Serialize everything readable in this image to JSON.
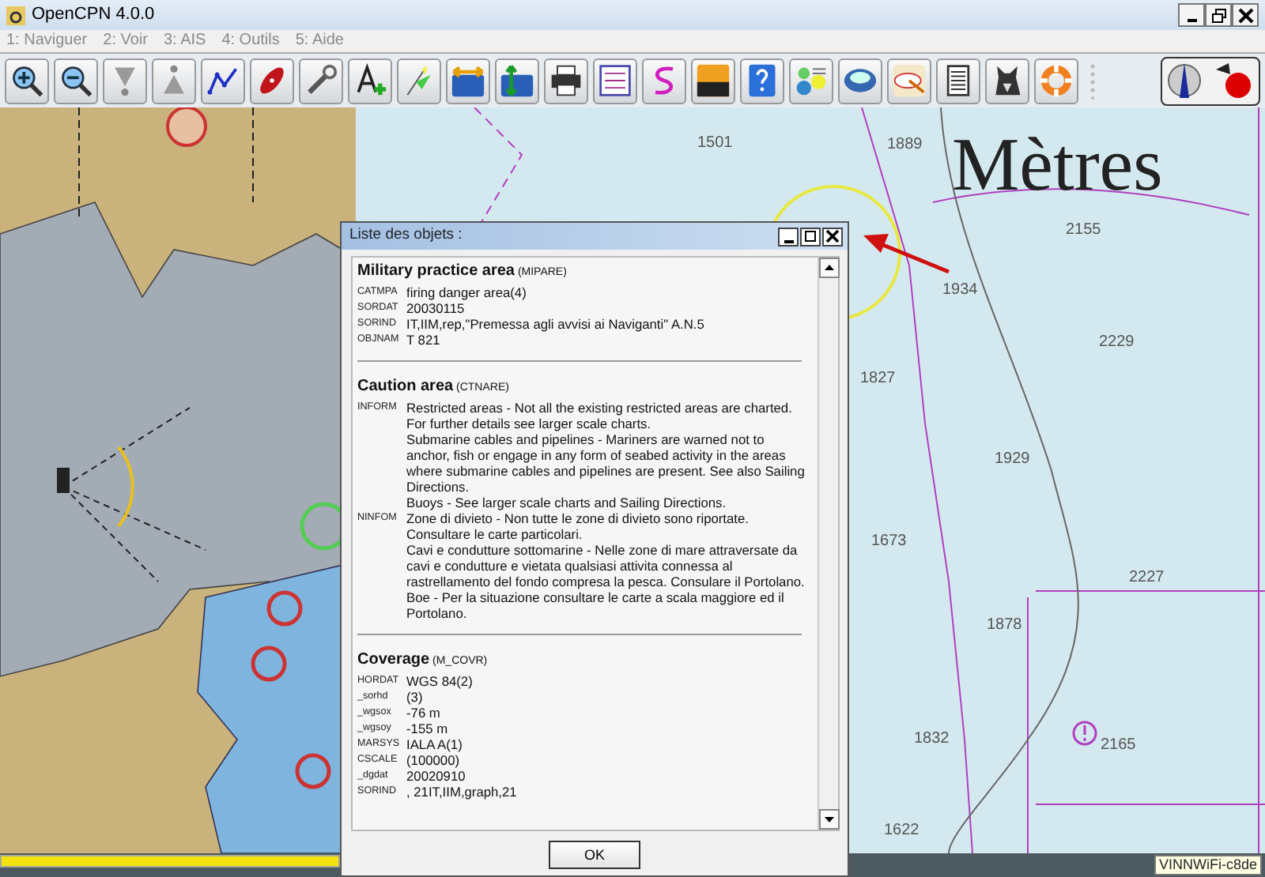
{
  "window": {
    "title": "OpenCPN 4.0.0"
  },
  "menu": [
    "1: Naviguer",
    "2: Voir",
    "3: AIS",
    "4: Outils",
    "5: Aide"
  ],
  "chart": {
    "units_label": "Mètres",
    "soundings": [
      "1501",
      "1889",
      "2155",
      "1934",
      "2229",
      "1827",
      "1929",
      "1673",
      "2227",
      "1878",
      "1832",
      "2165",
      "1622"
    ]
  },
  "dialog": {
    "title": "Liste des objets :",
    "sections": [
      {
        "name": "Military practice area",
        "code": "(MIPARE)",
        "attributes": [
          {
            "key": "CATMPA",
            "value": [
              "firing danger area(4)"
            ]
          },
          {
            "key": "SORDAT",
            "value": [
              "20030115"
            ]
          },
          {
            "key": "SORIND",
            "value": [
              "IT,IIM,rep,\"Premessa agli avvisi ai Naviganti\" A.N.5"
            ]
          },
          {
            "key": "OBJNAM",
            "value": [
              "T 821"
            ]
          }
        ]
      },
      {
        "name": "Caution area",
        "code": "(CTNARE)",
        "attributes": [
          {
            "key": "INFORM",
            "value": [
              "Restricted areas - Not all the existing restricted areas are charted.",
              "For further details see larger scale charts.",
              "Submarine cables and pipelines - Mariners are warned not to anchor, fish or engage in any form of seabed activity in the areas where submarine cables and pipelines are present. See also Sailing Directions.",
              "Buoys - See larger scale charts and Sailing Directions."
            ]
          },
          {
            "key": "NINFOM",
            "value": [
              "Zone di divieto - Non tutte le zone di divieto sono riportate.",
              "Consultare le carte particolari.",
              "Cavi e condutture sottomarine - Nelle zone di mare attraversate da cavi e condutture e vietata qualsiasi attivita connessa al rastrellamento del fondo compresa la pesca. Consulare il Portolano.",
              "Boe - Per la situazione consultare le carte a scala maggiore ed il Portolano."
            ]
          }
        ]
      },
      {
        "name": "Coverage",
        "code": "(M_COVR)",
        "attributes": [
          {
            "key": "HORDAT",
            "value": [
              "WGS 84(2)"
            ]
          },
          {
            "key": "_sorhd",
            "value": [
              "(3)"
            ]
          },
          {
            "key": "_wgsox",
            "value": [
              "-76 m"
            ]
          },
          {
            "key": "_wgsoy",
            "value": [
              "-155 m"
            ]
          },
          {
            "key": "MARSYS",
            "value": [
              "IALA A(1)"
            ]
          },
          {
            "key": "CSCALE",
            "value": [
              "(100000)"
            ]
          },
          {
            "key": "_dgdat",
            "value": [
              "20020910"
            ]
          },
          {
            "key": "SORIND",
            "value": [
              ", 21IT,IIM,graph,21"
            ]
          }
        ]
      }
    ],
    "button": "OK"
  },
  "status_bar": {
    "tooltip": "VINNWiFi-c8de"
  }
}
